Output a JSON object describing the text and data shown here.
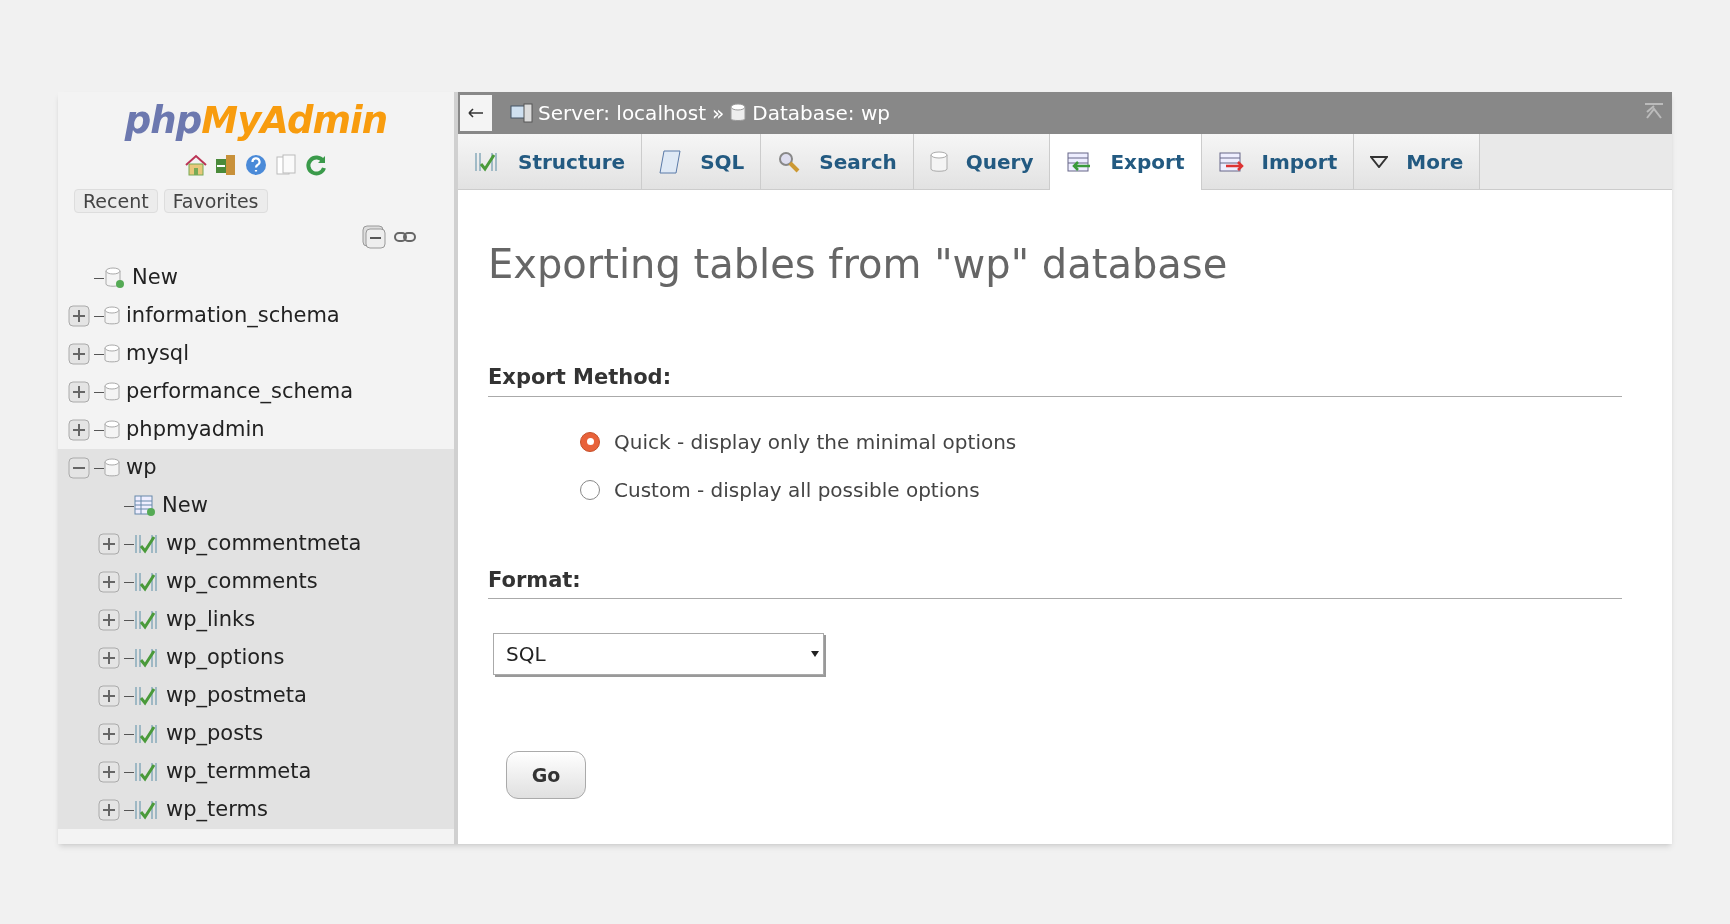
{
  "logo": {
    "part1": "php",
    "part2": "MyAdmin"
  },
  "nav_tabs": [
    {
      "label": "Recent"
    },
    {
      "label": "Favorites"
    }
  ],
  "tree": [
    {
      "label": "New",
      "kind": "new"
    },
    {
      "label": "information_schema",
      "kind": "db",
      "expanded": false
    },
    {
      "label": "mysql",
      "kind": "db",
      "expanded": false
    },
    {
      "label": "performance_schema",
      "kind": "db",
      "expanded": false
    },
    {
      "label": "phpmyadmin",
      "kind": "db",
      "expanded": false
    },
    {
      "label": "wp",
      "kind": "db",
      "expanded": true,
      "children": [
        {
          "label": "New",
          "kind": "new"
        },
        {
          "label": "wp_commentmeta",
          "kind": "table",
          "expanded": false
        },
        {
          "label": "wp_comments",
          "kind": "table",
          "expanded": false
        },
        {
          "label": "wp_links",
          "kind": "table",
          "expanded": false
        },
        {
          "label": "wp_options",
          "kind": "table",
          "expanded": false
        },
        {
          "label": "wp_postmeta",
          "kind": "table",
          "expanded": false
        },
        {
          "label": "wp_posts",
          "kind": "table",
          "expanded": false
        },
        {
          "label": "wp_termmeta",
          "kind": "table",
          "expanded": false
        },
        {
          "label": "wp_terms",
          "kind": "table",
          "expanded": false
        }
      ]
    }
  ],
  "breadcrumb": {
    "server": "Server: localhost",
    "separator": "»",
    "database": "Database: wp"
  },
  "tabs": [
    {
      "label": "Structure",
      "kind": "structure",
      "selected": false
    },
    {
      "label": "SQL",
      "kind": "sql",
      "selected": false
    },
    {
      "label": "Search",
      "kind": "search",
      "selected": false
    },
    {
      "label": "Query",
      "kind": "query",
      "selected": false
    },
    {
      "label": "Export",
      "kind": "export",
      "selected": true
    },
    {
      "label": "Import",
      "kind": "import",
      "selected": false
    },
    {
      "label": "More",
      "kind": "more",
      "selected": false
    }
  ],
  "heading": "Exporting tables from \"wp\" database",
  "export_method": {
    "title": "Export Method:",
    "options": [
      {
        "label": "Quick - display only the minimal options",
        "selected": true
      },
      {
        "label": "Custom - display all possible options",
        "selected": false
      }
    ]
  },
  "format": {
    "title": "Format:",
    "value": "SQL"
  },
  "go_button": "Go"
}
